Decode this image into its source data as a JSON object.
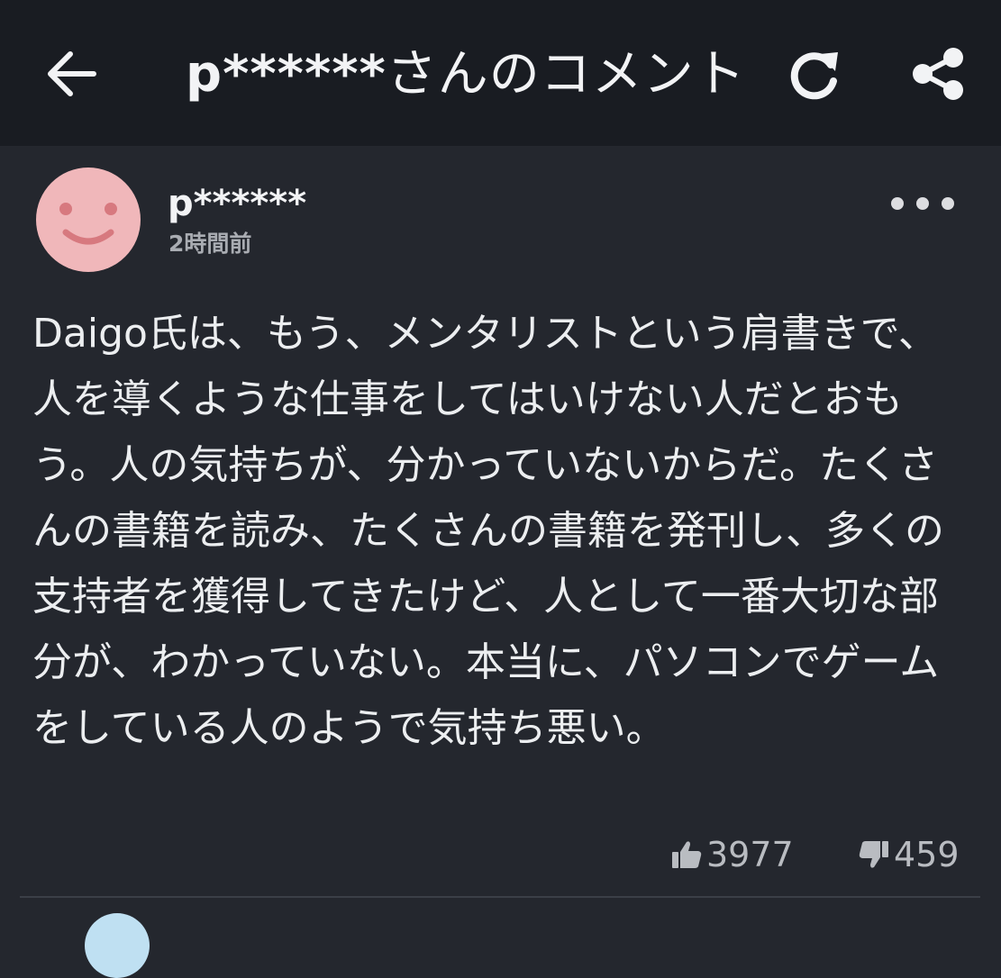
{
  "header": {
    "title_user": "p******",
    "title_suffix": "さんのコメント",
    "back_icon": "arrow-left-icon",
    "refresh_icon": "refresh-icon",
    "share_icon": "share-icon"
  },
  "comment": {
    "username": "p******",
    "time": "2時間前",
    "avatar_icon": "smiley-face-icon",
    "avatar_color": "#f0b7ba",
    "text": "Daigo氏は、もう、メンタリストという肩書きで、人を導くような仕事をしてはいけない人だとおもう。人の気持ちが、分かっていないからだ。たくさんの書籍を読み、たくさんの書籍を発刊し、多くの支持者を獲得してきたけど、人として一番大切な部分が、わかっていない。本当に、パソコンでゲームをしている人のようで気持ち悪い。",
    "likes": "3977",
    "dislikes": "459"
  },
  "colors": {
    "header_bg": "#191c22",
    "page_bg": "#24272e",
    "text": "#eceef0",
    "muted": "#a9acb2"
  }
}
